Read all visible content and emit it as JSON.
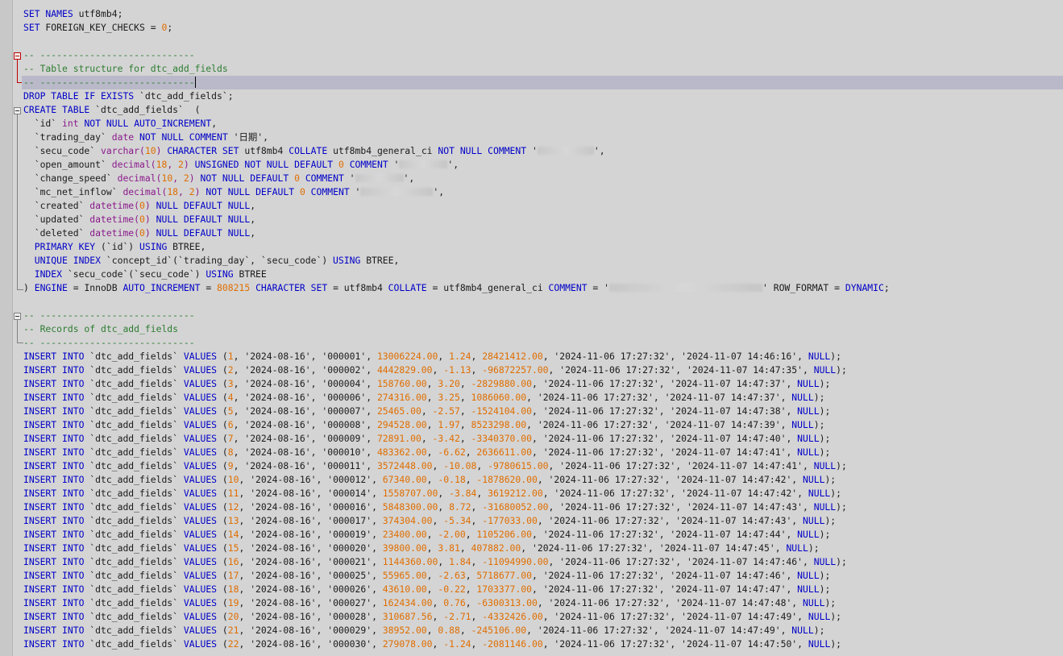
{
  "editor": {
    "header_lines": [
      "SET NAMES utf8mb4;",
      "SET FOREIGN_KEY_CHECKS = 0;"
    ],
    "comment_rule": "-- ----------------------------",
    "comment_table_structure": "-- Table structure for dtc_add_fields",
    "drop_stmt": "DROP TABLE IF EXISTS `dtc_add_fields`;",
    "create_stmt": "CREATE TABLE `dtc_add_fields`  (",
    "columns": [
      {
        "name": "`id`",
        "type": "int",
        "rest": "NOT NULL AUTO_INCREMENT,"
      },
      {
        "name": "`trading_day`",
        "type": "date",
        "rest": "NOT NULL COMMENT '日期',"
      },
      {
        "name": "`secu_code`",
        "type": "varchar(10)",
        "rest": "CHARACTER SET utf8mb4 COLLATE utf8mb4_general_ci NOT NULL COMMENT '",
        "tail": "',"
      },
      {
        "name": "`open_amount`",
        "type": "decimal(18, 2)",
        "rest": "UNSIGNED NOT NULL DEFAULT 0 COMMENT '",
        "tail": "',"
      },
      {
        "name": "`change_speed`",
        "type": "decimal(10, 2)",
        "rest": "NOT NULL DEFAULT 0 COMMENT '",
        "tail": "',"
      },
      {
        "name": "`mc_net_inflow`",
        "type": "decimal(18, 2)",
        "rest": "NOT NULL DEFAULT 0 COMMENT '",
        "tail": "',"
      },
      {
        "name": "`created`",
        "type": "datetime(0)",
        "rest": "NULL DEFAULT NULL,"
      },
      {
        "name": "`updated`",
        "type": "datetime(0)",
        "rest": "NULL DEFAULT NULL,"
      },
      {
        "name": "`deleted`",
        "type": "datetime(0)",
        "rest": "NULL DEFAULT NULL,"
      }
    ],
    "primary_key": "PRIMARY KEY (`id`) USING BTREE,",
    "unique_index": "UNIQUE INDEX `concept_id`(`trading_day`, `secu_code`) USING BTREE,",
    "index_line": "INDEX `secu_code`(`secu_code`) USING BTREE",
    "engine_line": ") ENGINE = InnoDB AUTO_INCREMENT = 808215 CHARACTER SET = utf8mb4 COLLATE = utf8mb4_general_ci COMMENT = '",
    "engine_tail": "' ROW_FORMAT = DYNAMIC;",
    "comment_records": "-- Records of dtc_add_fields",
    "insert_prefix": "INSERT INTO `dtc_add_fields` VALUES",
    "rows": [
      [
        1,
        "2024-08-16",
        "000001",
        "13006224.00",
        "1.24",
        "28421412.00",
        "2024-11-06 17:27:32",
        "2024-11-07 14:46:16"
      ],
      [
        2,
        "2024-08-16",
        "000002",
        "4442829.00",
        "-1.13",
        "-96872257.00",
        "2024-11-06 17:27:32",
        "2024-11-07 14:47:35"
      ],
      [
        3,
        "2024-08-16",
        "000004",
        "158760.00",
        "3.20",
        "-2829880.00",
        "2024-11-06 17:27:32",
        "2024-11-07 14:47:37"
      ],
      [
        4,
        "2024-08-16",
        "000006",
        "274316.00",
        "3.25",
        "1086060.00",
        "2024-11-06 17:27:32",
        "2024-11-07 14:47:37"
      ],
      [
        5,
        "2024-08-16",
        "000007",
        "25465.00",
        "-2.57",
        "-1524104.00",
        "2024-11-06 17:27:32",
        "2024-11-07 14:47:38"
      ],
      [
        6,
        "2024-08-16",
        "000008",
        "294528.00",
        "1.97",
        "8523298.00",
        "2024-11-06 17:27:32",
        "2024-11-07 14:47:39"
      ],
      [
        7,
        "2024-08-16",
        "000009",
        "72891.00",
        "-3.42",
        "-3340370.00",
        "2024-11-06 17:27:32",
        "2024-11-07 14:47:40"
      ],
      [
        8,
        "2024-08-16",
        "000010",
        "483362.00",
        "-6.62",
        "2636611.00",
        "2024-11-06 17:27:32",
        "2024-11-07 14:47:41"
      ],
      [
        9,
        "2024-08-16",
        "000011",
        "3572448.00",
        "-10.08",
        "-9780615.00",
        "2024-11-06 17:27:32",
        "2024-11-07 14:47:41"
      ],
      [
        10,
        "2024-08-16",
        "000012",
        "67340.00",
        "-0.18",
        "-1878620.00",
        "2024-11-06 17:27:32",
        "2024-11-07 14:47:42"
      ],
      [
        11,
        "2024-08-16",
        "000014",
        "1558707.00",
        "-3.84",
        "3619212.00",
        "2024-11-06 17:27:32",
        "2024-11-07 14:47:42"
      ],
      [
        12,
        "2024-08-16",
        "000016",
        "5848300.00",
        "8.72",
        "-31680052.00",
        "2024-11-06 17:27:32",
        "2024-11-07 14:47:43"
      ],
      [
        13,
        "2024-08-16",
        "000017",
        "374304.00",
        "-5.34",
        "-177033.00",
        "2024-11-06 17:27:32",
        "2024-11-07 14:47:43"
      ],
      [
        14,
        "2024-08-16",
        "000019",
        "23400.00",
        "-2.00",
        "1105206.00",
        "2024-11-06 17:27:32",
        "2024-11-07 14:47:44"
      ],
      [
        15,
        "2024-08-16",
        "000020",
        "39800.00",
        "3.81",
        "407882.00",
        "2024-11-06 17:27:32",
        "2024-11-07 14:47:45"
      ],
      [
        16,
        "2024-08-16",
        "000021",
        "1144360.00",
        "1.84",
        "-11094990.00",
        "2024-11-06 17:27:32",
        "2024-11-07 14:47:46"
      ],
      [
        17,
        "2024-08-16",
        "000025",
        "55965.00",
        "-2.63",
        "5718677.00",
        "2024-11-06 17:27:32",
        "2024-11-07 14:47:46"
      ],
      [
        18,
        "2024-08-16",
        "000026",
        "43610.00",
        "-0.22",
        "1703377.00",
        "2024-11-06 17:27:32",
        "2024-11-07 14:47:47"
      ],
      [
        19,
        "2024-08-16",
        "000027",
        "162434.00",
        "0.76",
        "-6300313.00",
        "2024-11-06 17:27:32",
        "2024-11-07 14:47:48"
      ],
      [
        20,
        "2024-08-16",
        "000028",
        "310687.56",
        "-2.71",
        "-4332426.00",
        "2024-11-06 17:27:32",
        "2024-11-07 14:47:49"
      ],
      [
        21,
        "2024-08-16",
        "000029",
        "38952.00",
        "0.88",
        "-245106.00",
        "2024-11-06 17:27:32",
        "2024-11-07 14:47:49"
      ],
      [
        22,
        "2024-08-16",
        "000030",
        "279078.00",
        "-1.24",
        "-2081146.00",
        "2024-11-06 17:27:32",
        "2024-11-07 14:47:50"
      ]
    ]
  }
}
